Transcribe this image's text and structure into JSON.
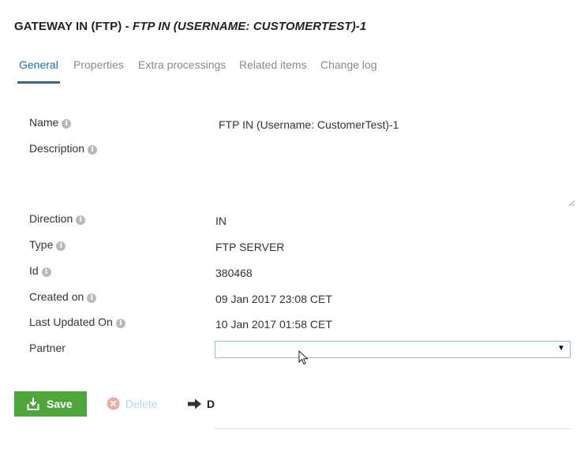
{
  "header": {
    "title_prefix": "GATEWAY IN (FTP) - ",
    "title_name": "FTP IN (USERNAME: CUSTOMERTEST)-1"
  },
  "tabs": [
    {
      "label": "General",
      "active": true
    },
    {
      "label": "Properties",
      "active": false
    },
    {
      "label": "Extra processings",
      "active": false
    },
    {
      "label": "Related items",
      "active": false
    },
    {
      "label": "Change log",
      "active": false
    }
  ],
  "form": {
    "name": {
      "label": "Name",
      "value": "FTP IN (Username: CustomerTest)-1"
    },
    "description": {
      "label": "Description",
      "value": ""
    },
    "direction": {
      "label": "Direction",
      "value": "IN"
    },
    "type": {
      "label": "Type",
      "value": "FTP SERVER"
    },
    "id": {
      "label": "Id",
      "value": "380468"
    },
    "created_on": {
      "label": "Created on",
      "value": "09 Jan 2017 23:08 CET"
    },
    "last_updated_on": {
      "label": "Last Updated On",
      "value": "10 Jan 2017 01:58 CET"
    },
    "partner": {
      "label": "Partner",
      "value": ""
    }
  },
  "info_glyph": "i",
  "select_arrow_glyph": "▼",
  "actions": {
    "save_label": "Save",
    "delete_label": "Delete",
    "third_label": "D"
  },
  "colors": {
    "accent": "#2c6aa0",
    "save_green": "#4ea53a",
    "delete_disabled": "#b8d6ea",
    "delete_icon": "#f2a9a9"
  }
}
